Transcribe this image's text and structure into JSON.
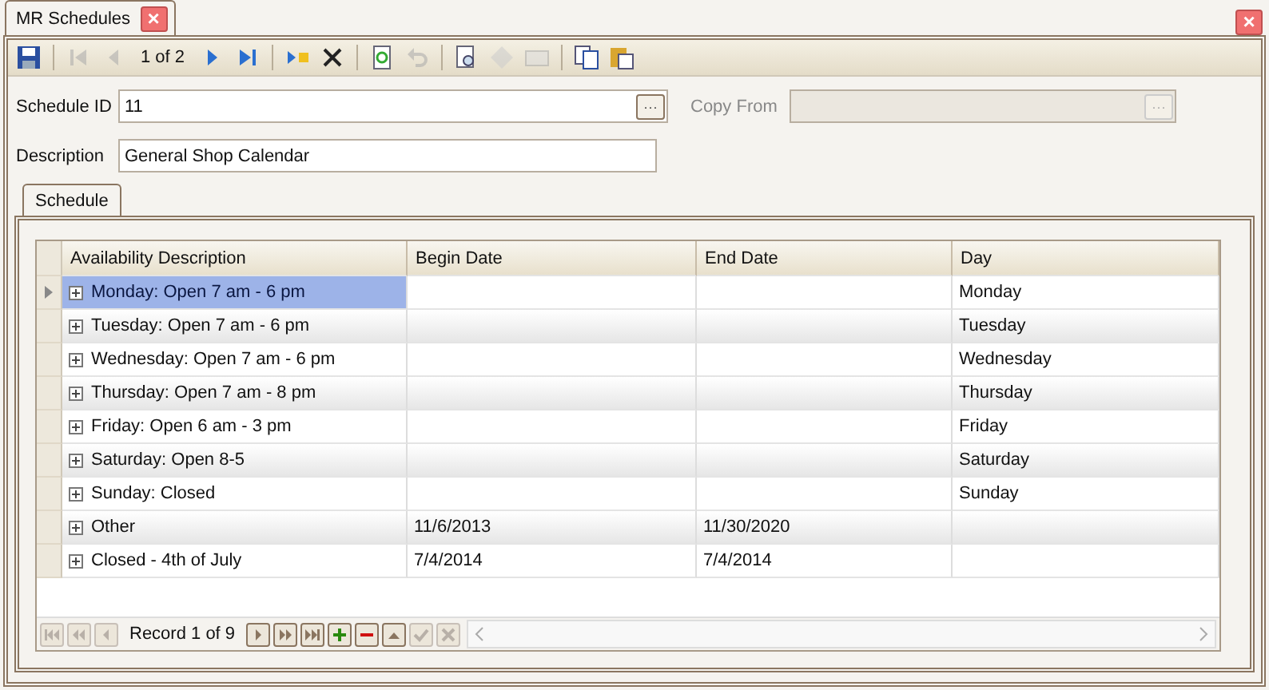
{
  "document_tab": {
    "label": "MR Schedules",
    "close": "×"
  },
  "window_close": "×",
  "toolbar": [
    {
      "kind": "save",
      "disabled": false
    },
    {
      "kind": "first",
      "disabled": true
    },
    {
      "kind": "prev",
      "disabled": true
    },
    {
      "kind": "position",
      "text": "1 of 2"
    },
    {
      "kind": "next",
      "disabled": false
    },
    {
      "kind": "last",
      "disabled": false
    },
    {
      "kind": "new",
      "disabled": false
    },
    {
      "kind": "delete",
      "disabled": false
    },
    {
      "kind": "refresh",
      "disabled": false
    },
    {
      "kind": "undo",
      "disabled": true
    },
    {
      "kind": "preview",
      "disabled": false
    },
    {
      "kind": "diamond",
      "disabled": true
    },
    {
      "kind": "mail",
      "disabled": true
    },
    {
      "kind": "copy",
      "disabled": false
    },
    {
      "kind": "paste",
      "disabled": false
    }
  ],
  "fields": {
    "schedule_id": {
      "label": "Schedule ID",
      "value": "11",
      "button": "···"
    },
    "copy_from": {
      "label": "Copy From",
      "button": "···",
      "disabled": true
    },
    "description": {
      "label": "Description",
      "value": "General Shop Calendar"
    }
  },
  "tabs": [
    {
      "label": "Schedule",
      "selected": true
    }
  ],
  "table": {
    "columns": [
      "Availability Description",
      "Begin Date",
      "End Date",
      "Day"
    ],
    "rows": [
      {
        "availability": "Monday: Open 7 am - 6 pm",
        "day": "Monday",
        "selected": true
      },
      {
        "availability": "Tuesday: Open 7 am - 6 pm",
        "day": "Tuesday",
        "selected": false
      },
      {
        "availability": "Wednesday: Open 7 am - 6 pm",
        "day": "Wednesday",
        "selected": false
      },
      {
        "availability": "Thursday: Open 7 am - 8 pm",
        "day": "Thursday",
        "selected": false
      },
      {
        "availability": "Friday: Open 6 am - 3 pm",
        "day": "Friday",
        "selected": false
      },
      {
        "availability": "Saturday: Open 8-5",
        "day": "Saturday",
        "selected": false
      },
      {
        "availability": "Sunday: Closed",
        "day": "Sunday",
        "selected": false
      },
      {
        "availability": "Other",
        "begin": "11/6/2013",
        "end": "11/30/2020",
        "selected": false
      },
      {
        "availability": "Closed - 4th of July",
        "begin": "7/4/2014",
        "end": "7/4/2014",
        "selected": false
      }
    ]
  },
  "navigator": [
    {
      "kind": "first",
      "disabled": true
    },
    {
      "kind": "prevpage",
      "disabled": true
    },
    {
      "kind": "prev",
      "disabled": true
    },
    {
      "kind": "text",
      "text": "Record 1 of 9"
    },
    {
      "kind": "next",
      "disabled": false
    },
    {
      "kind": "nextpage",
      "disabled": false
    },
    {
      "kind": "last",
      "disabled": false
    },
    {
      "kind": "add",
      "disabled": false
    },
    {
      "kind": "remove",
      "disabled": false
    },
    {
      "kind": "up",
      "disabled": false
    },
    {
      "kind": "check",
      "disabled": true
    },
    {
      "kind": "cancel",
      "disabled": true
    }
  ]
}
